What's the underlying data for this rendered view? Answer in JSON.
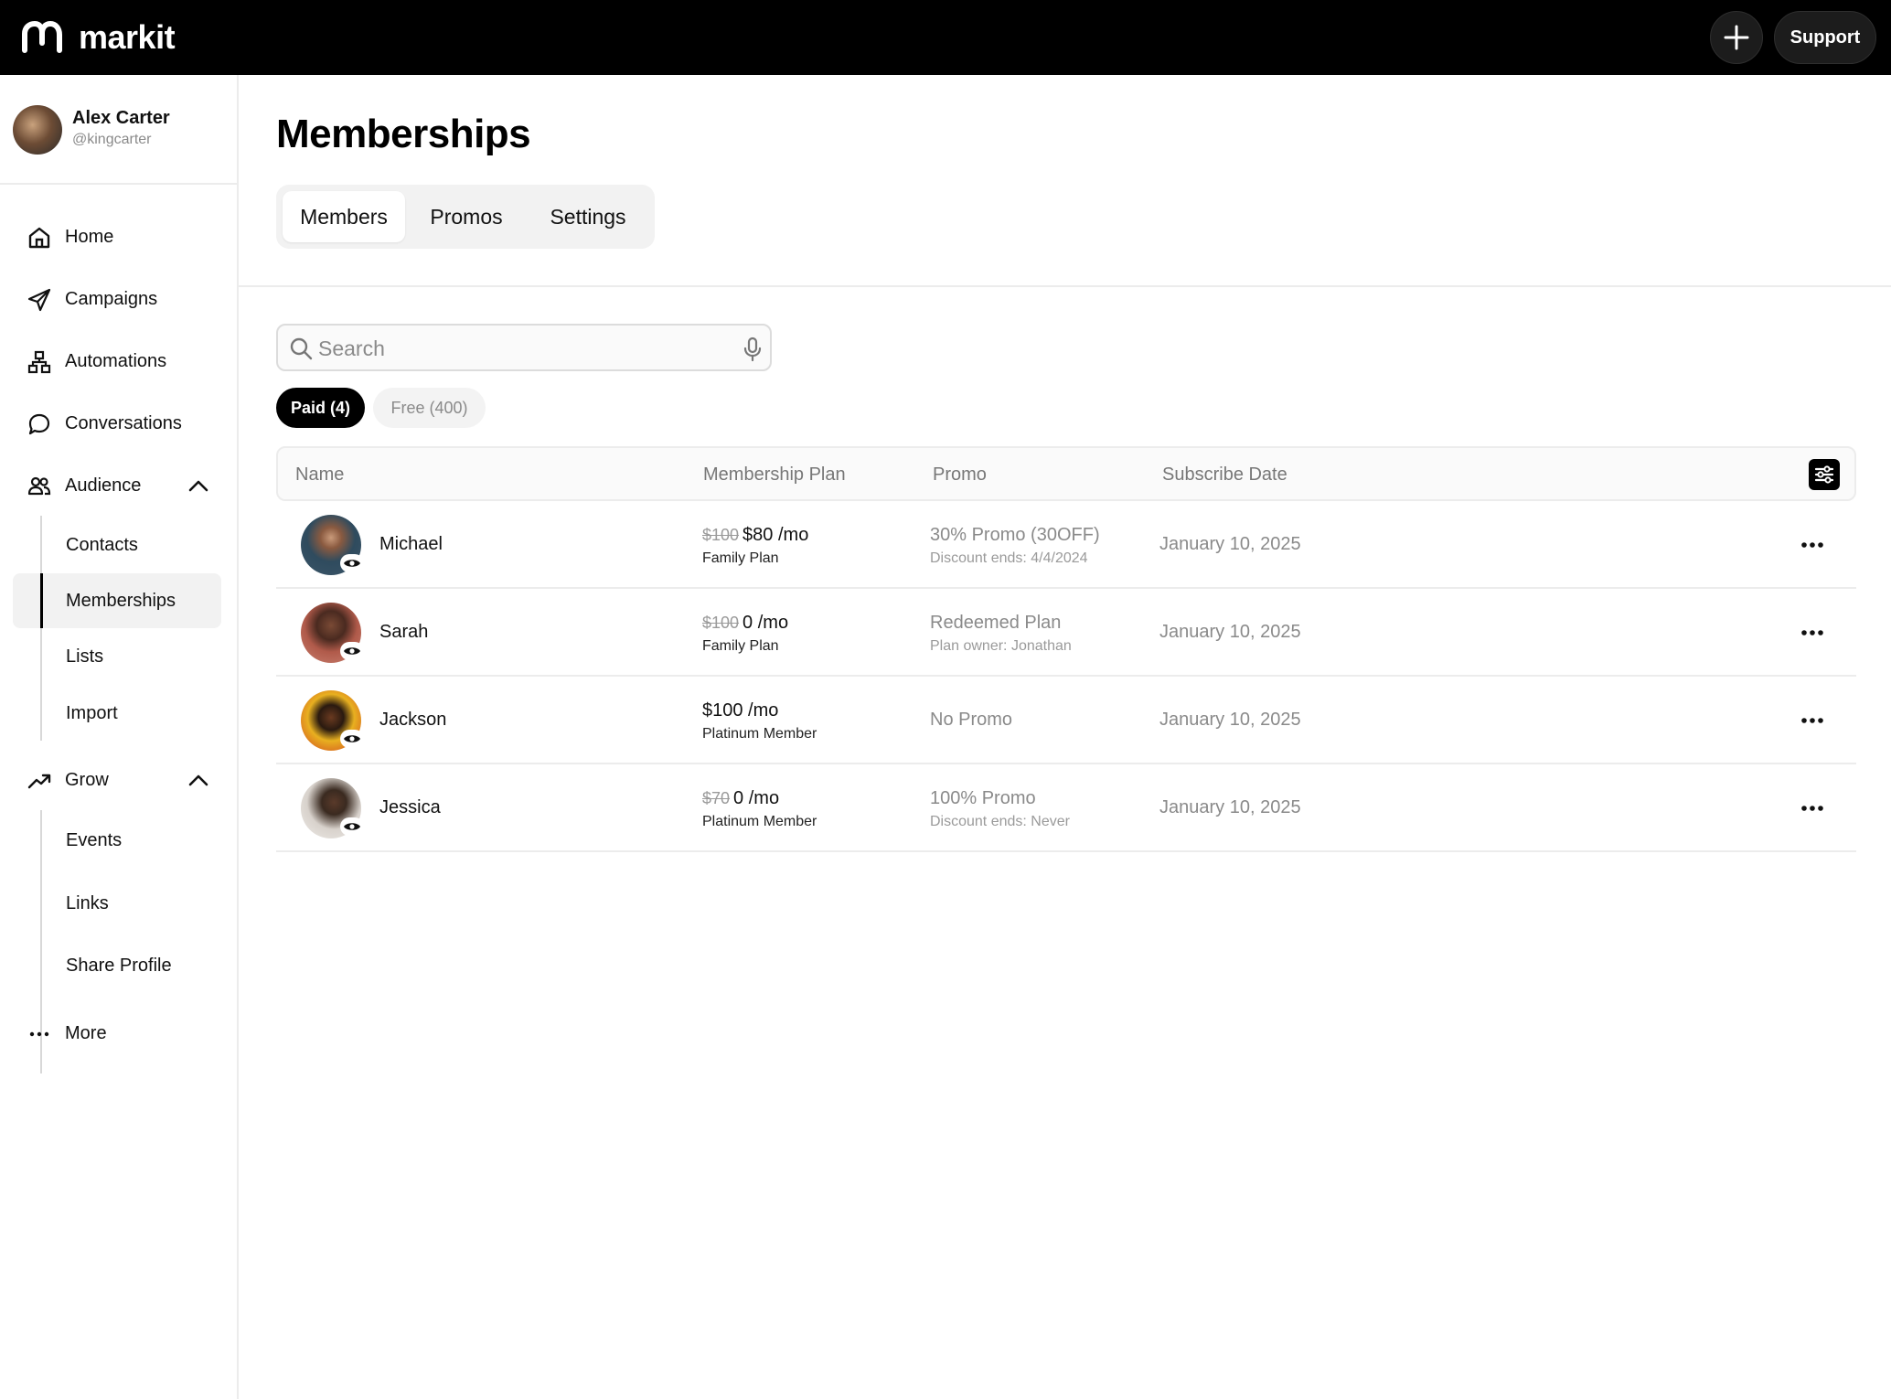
{
  "app": {
    "brand_name": "markit",
    "support_label": "Support",
    "icons": {
      "logo": "markit-logo",
      "add": "plus-icon"
    }
  },
  "profile": {
    "name": "Alex Carter",
    "handle": "@kingcarter"
  },
  "nav": {
    "home": "Home",
    "campaigns": "Campaigns",
    "automations": "Automations",
    "conversations": "Conversations",
    "audience": "Audience",
    "audience_items": [
      "Contacts",
      "Memberships",
      "Lists",
      "Import"
    ],
    "grow": "Grow",
    "grow_items": [
      "Events",
      "Links",
      "Share Profile"
    ],
    "more": "More",
    "active_item": "Memberships"
  },
  "page": {
    "title": "Memberships",
    "tabs": [
      "Members",
      "Promos",
      "Settings"
    ],
    "active_tab": "Members"
  },
  "search": {
    "placeholder": "Search",
    "value": ""
  },
  "filters": {
    "paid": "Paid (4)",
    "free": "Free (400)",
    "active": "paid"
  },
  "table": {
    "columns": [
      "Name",
      "Membership Plan",
      "Promo",
      "Subscribe Date"
    ],
    "rows": [
      {
        "name": "Michael",
        "old_price": "$100",
        "price": "$80 /mo",
        "plan": "Family Plan",
        "promo": "30% Promo (30OFF)",
        "promo_detail": "Discount ends: 4/4/2024",
        "date": "January 10, 2025"
      },
      {
        "name": "Sarah",
        "old_price": "$100",
        "price": "0 /mo",
        "plan": "Family Plan",
        "promo": "Redeemed Plan",
        "promo_detail": "Plan owner: Jonathan",
        "date": "January 10, 2025"
      },
      {
        "name": "Jackson",
        "old_price": "",
        "price": "$100 /mo",
        "plan": "Platinum Member",
        "promo": "No Promo",
        "promo_detail": "",
        "date": "January 10, 2025"
      },
      {
        "name": "Jessica",
        "old_price": "$70",
        "price": "0 /mo",
        "plan": "Platinum Member",
        "promo": "100% Promo",
        "promo_detail": "Discount ends: Never",
        "date": "January 10, 2025"
      }
    ]
  },
  "colors": {
    "topbar": "#000000",
    "accent": "#000000",
    "muted_text": "#8a8a8a",
    "border": "#ececec"
  }
}
